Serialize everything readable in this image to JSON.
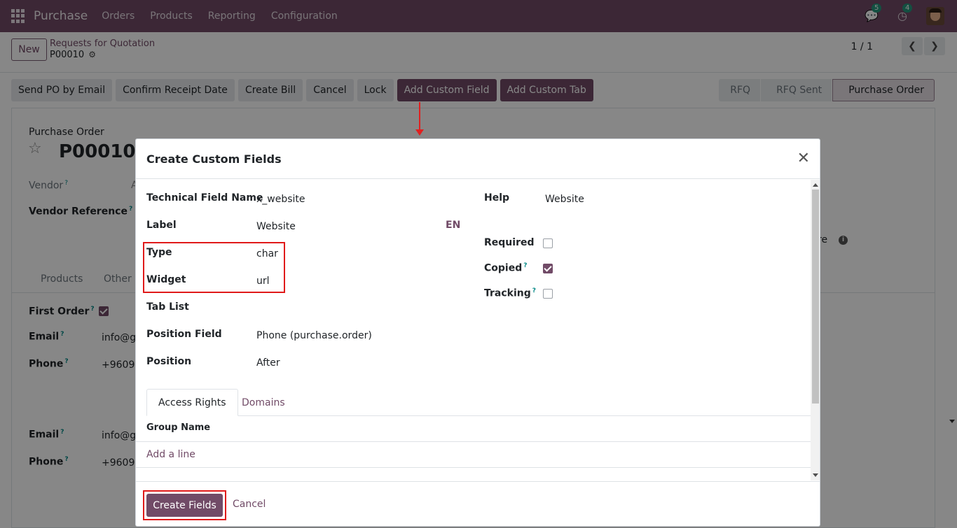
{
  "navbar": {
    "brand": "Purchase",
    "menu": [
      "Orders",
      "Products",
      "Reporting",
      "Configuration"
    ],
    "messages_count": "5",
    "activities_count": "4"
  },
  "control_panel": {
    "new_label": "New",
    "breadcrumb_parent": "Requests for Quotation",
    "breadcrumb_current": "P00010",
    "pager": "1 / 1"
  },
  "actions": [
    "Send PO by Email",
    "Confirm Receipt Date",
    "Create Bill",
    "Cancel",
    "Lock",
    "Add Custom Field",
    "Add Custom Tab"
  ],
  "status_stages": [
    "RFQ",
    "RFQ Sent",
    "Purchase Order"
  ],
  "background_form": {
    "doc_type": "Purchase Order",
    "doc_name": "P00010",
    "vendor_label": "Vendor",
    "vendor_ref_label": "Vendor Reference",
    "tab_products": "Products",
    "tab_other": "Other I",
    "first_order_label": "First Order",
    "email_label": "Email",
    "email_value": "info@g",
    "phone_label": "Phone",
    "phone_value": "+9609 6",
    "email_label_2": "Email",
    "email_value_2": "info@g",
    "phone_label_2": "Phone",
    "phone_value_2": "+9609 6",
    "vendor_value_fragment": "A",
    "right_fragment": "re"
  },
  "modal": {
    "title": "Create Custom Fields",
    "fields": {
      "technical_name_label": "Technical Field Name",
      "technical_name_value": "x_website",
      "label_label": "Label",
      "label_value": "Website",
      "lang": "EN",
      "type_label": "Type",
      "type_value": "char",
      "widget_label": "Widget",
      "widget_value": "url",
      "tab_list_label": "Tab List",
      "position_field_label": "Position Field",
      "position_field_value": "Phone (purchase.order)",
      "position_label": "Position",
      "position_value": "After",
      "help_label": "Help",
      "help_value": "Website",
      "required_label": "Required",
      "required_checked": false,
      "copied_label": "Copied",
      "copied_checked": true,
      "tracking_label": "Tracking",
      "tracking_checked": false
    },
    "tabs": [
      "Access Rights",
      "Domains"
    ],
    "table_header": "Group Name",
    "add_line": "Add a line",
    "create_button": "Create Fields",
    "cancel_button": "Cancel"
  },
  "colors": {
    "brand": "#714b67",
    "highlight": "#e01a1a"
  }
}
